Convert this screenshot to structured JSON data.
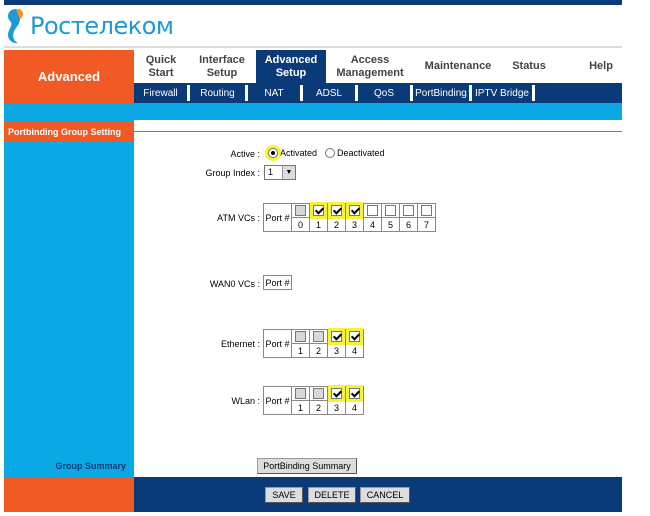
{
  "brand": {
    "name": "Ростелеком",
    "color_orange": "#f15a24",
    "color_blue": "#1e9ad6",
    "nav_dark": "#0a3a78",
    "nav_light": "#0ba8e6"
  },
  "side_title": "Advanced",
  "tabs": [
    {
      "label": "Quick Start"
    },
    {
      "label": "Interface Setup"
    },
    {
      "label": "Advanced Setup",
      "active": true
    },
    {
      "label": "Access Management"
    },
    {
      "label": "Maintenance"
    },
    {
      "label": "Status"
    },
    {
      "label": "Help"
    }
  ],
  "subnav": [
    "Firewall",
    "Routing",
    "NAT",
    "ADSL",
    "QoS",
    "PortBinding",
    "IPTV Bridge"
  ],
  "section_title": "Portbinding Group Setting",
  "form": {
    "active_label": "Active :",
    "activated": "Activated",
    "deactivated": "Deactivated",
    "active_value": "Activated",
    "group_index_label": "Group Index :",
    "group_index": "1",
    "port_hdr": "Port #",
    "atm_label": "ATM VCs :",
    "atm_ports": [
      "0",
      "1",
      "2",
      "3",
      "4",
      "5",
      "6",
      "7"
    ],
    "atm_checked": [
      false,
      true,
      true,
      true,
      false,
      false,
      false,
      false
    ],
    "atm_disabled": [
      true,
      false,
      false,
      false,
      false,
      false,
      false,
      false
    ],
    "wan_label": "WAN0 VCs :",
    "eth_label": "Ethernet :",
    "eth_ports": [
      "1",
      "2",
      "3",
      "4"
    ],
    "eth_checked": [
      false,
      false,
      true,
      true
    ],
    "eth_disabled": [
      true,
      true,
      false,
      false
    ],
    "wlan_label": "WLan :",
    "wlan_ports": [
      "1",
      "2",
      "3",
      "4"
    ],
    "wlan_checked": [
      false,
      false,
      true,
      true
    ],
    "wlan_disabled": [
      true,
      true,
      false,
      false
    ]
  },
  "group_summary_label": "Group Summary",
  "summary_button": "PortBinding Summary",
  "buttons": {
    "save": "SAVE",
    "delete": "DELETE",
    "cancel": "CANCEL"
  }
}
